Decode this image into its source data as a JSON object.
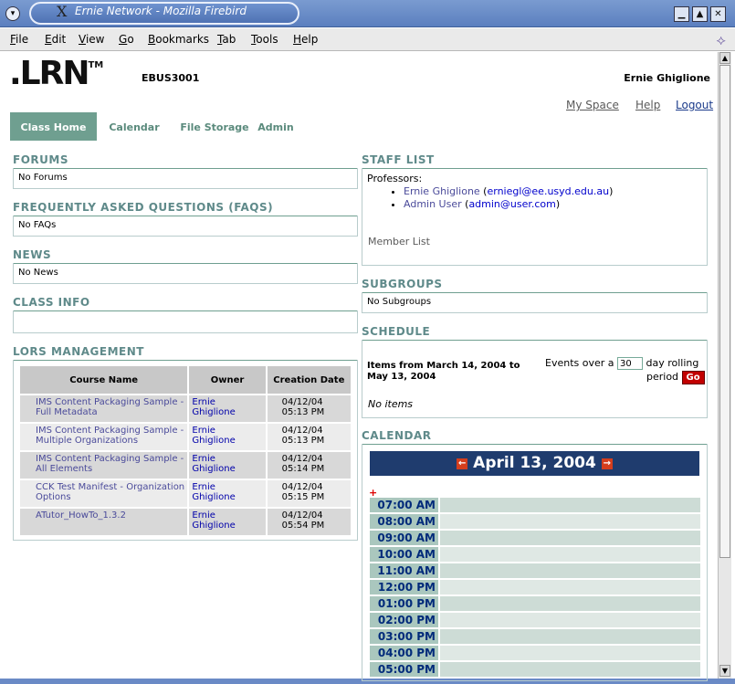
{
  "window": {
    "title": "Ernie Network - Mozilla Firebird",
    "title_glyph": "X"
  },
  "menubar": {
    "items": [
      {
        "underline": "F",
        "rest": "ile"
      },
      {
        "underline": "E",
        "rest": "dit"
      },
      {
        "underline": "V",
        "rest": "iew"
      },
      {
        "underline": "G",
        "rest": "o"
      },
      {
        "underline": "B",
        "rest": "ookmarks"
      },
      {
        "underline": "T",
        "rest": "ab"
      },
      {
        "underline": "T",
        "rest": "ools"
      },
      {
        "underline": "H",
        "rest": "elp"
      }
    ]
  },
  "header": {
    "logo": ".LRN",
    "logo_tm": "TM",
    "course_code": "EBUS3001",
    "user_name": "Ernie Ghiglione",
    "links": {
      "my_space": "My Space",
      "help": "Help",
      "logout": "Logout"
    }
  },
  "tabs": [
    "Class Home",
    "Calendar",
    "File Storage",
    "Admin"
  ],
  "left": {
    "forums": {
      "title": "FORUMS",
      "body": "No Forums"
    },
    "faqs": {
      "title": "FREQUENTLY ASKED QUESTIONS (FAQS)",
      "body": "No FAQs"
    },
    "news": {
      "title": "NEWS",
      "body": "No News"
    },
    "class_info": {
      "title": "CLASS INFO",
      "body": ""
    },
    "lors": {
      "title": "LORS MANAGEMENT",
      "columns": [
        "Course Name",
        "Owner",
        "Creation Date"
      ],
      "rows": [
        {
          "name": "IMS Content Packaging Sample - Full Metadata",
          "owner": "Ernie Ghiglione",
          "date": "04/12/04",
          "time": "05:13 PM"
        },
        {
          "name": "IMS Content Packaging Sample - Multiple Organizations",
          "owner": "Ernie Ghiglione",
          "date": "04/12/04",
          "time": "05:13 PM"
        },
        {
          "name": "IMS Content Packaging Sample - All Elements",
          "owner": "Ernie Ghiglione",
          "date": "04/12/04",
          "time": "05:14 PM"
        },
        {
          "name": "CCK Test Manifest - Organization Options",
          "owner": "Ernie Ghiglione",
          "date": "04/12/04",
          "time": "05:15 PM"
        },
        {
          "name": "ATutor_HowTo_1.3.2",
          "owner": "Ernie Ghiglione",
          "date": "04/12/04",
          "time": "05:54 PM"
        }
      ]
    }
  },
  "right": {
    "staff": {
      "title": "STAFF LIST",
      "professors_label": "Professors:",
      "people": [
        {
          "name": "Ernie Ghiglione",
          "email": "erniegl@ee.usyd.edu.au"
        },
        {
          "name": "Admin User",
          "email": "admin@user.com"
        }
      ],
      "member_list": "Member List"
    },
    "subgroups": {
      "title": "SUBGROUPS",
      "body": "No Subgroups"
    },
    "schedule": {
      "title": "SCHEDULE",
      "range": "Items from March 14, 2004 to May 13, 2004",
      "events_over": "Events over a",
      "days_value": "30",
      "day_rolling": "day rolling",
      "period": "period",
      "go": "Go",
      "no_items": "No items"
    },
    "calendar": {
      "title": "CALENDAR",
      "date": "April 13, 2004",
      "add_glyph": "+",
      "times": [
        "07:00 AM",
        "08:00 AM",
        "09:00 AM",
        "10:00 AM",
        "11:00 AM",
        "12:00 PM",
        "01:00 PM",
        "02:00 PM",
        "03:00 PM",
        "04:00 PM",
        "05:00 PM"
      ]
    }
  }
}
